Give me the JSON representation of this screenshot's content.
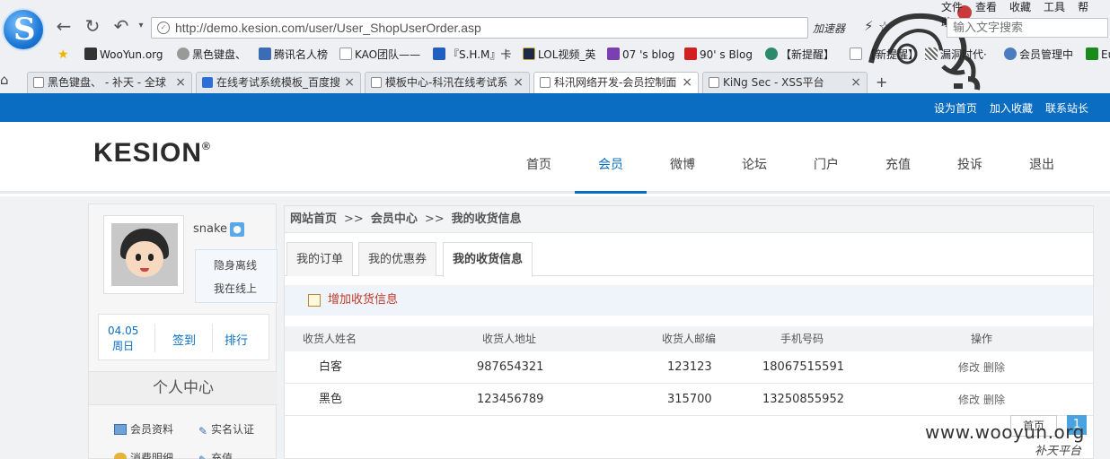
{
  "browser": {
    "url": "http://demo.kesion.com/user/User_ShopUserOrder.asp",
    "accelerator": "加速器",
    "menu": [
      "文件",
      "查看",
      "收藏",
      "工具",
      "帮助"
    ],
    "search_placeholder": "输入文字搜索",
    "bookmarks": [
      {
        "label": "WooYun.org",
        "icon": "wooyun-icon",
        "color": "#333333"
      },
      {
        "label": "黑色键盘、",
        "icon": "star-icon",
        "color": "#888888"
      },
      {
        "label": "腾讯名人榜",
        "icon": "shield-icon",
        "color": "#3b6db5"
      },
      {
        "label": "KAO团队——",
        "icon": "page-icon",
        "color": "#999999"
      },
      {
        "label": "『S.H.M』卡",
        "icon": "blue-square-icon",
        "color": "#1f5fbf"
      },
      {
        "label": "LOL视频_英",
        "icon": "lol-icon",
        "color": "#c9a23a"
      },
      {
        "label": "07 's blog",
        "icon": "purple-icon",
        "color": "#7a3fb0"
      },
      {
        "label": "90' s Blog",
        "icon": "red-90-icon",
        "color": "#d02020"
      },
      {
        "label": "【新提醒】",
        "icon": "circle-icon",
        "color": "#2a8a6a"
      },
      {
        "label": "【新提醒】",
        "icon": "page-icon",
        "color": "#999999"
      },
      {
        "label": "漏洞时代·",
        "icon": "pattern-icon",
        "color": "#666666"
      },
      {
        "label": "会员管理中",
        "icon": "people-icon",
        "color": "#4c7cc0"
      },
      {
        "label": "Eu",
        "icon": "green-icon",
        "color": "#1a8a1a"
      }
    ],
    "tabs": [
      {
        "label": "黑色键盘、 - 补天 - 全球",
        "active": false
      },
      {
        "label": "在线考试系统模板_百度搜",
        "active": false
      },
      {
        "label": "模板中心-科汛在线考试系",
        "active": false
      },
      {
        "label": "科汛网络开发-会员控制面",
        "active": true
      },
      {
        "label": "KiNg Sec - XSS平台",
        "active": false
      }
    ]
  },
  "site": {
    "top_links": [
      "设为首页",
      "加入收藏",
      "联系站长"
    ],
    "logo": "KESION",
    "logo_mark": "®",
    "nav": [
      {
        "label": "首页",
        "active": false
      },
      {
        "label": "会员",
        "active": true
      },
      {
        "label": "微博",
        "active": false
      },
      {
        "label": "论坛",
        "active": false
      },
      {
        "label": "门户",
        "active": false
      },
      {
        "label": "充值",
        "active": false
      },
      {
        "label": "投诉",
        "active": false
      },
      {
        "label": "退出",
        "active": false
      }
    ],
    "accent": "#0a6dc2"
  },
  "sidebar": {
    "username": "snake",
    "status_options": [
      "隐身离线",
      "我在线上"
    ],
    "sign_date": "04.05",
    "sign_weekday": "周日",
    "sign_label": "签到",
    "rank_label": "排行",
    "center_title": "个人中心",
    "links": [
      "会员资料",
      "实名认证",
      "消费明细",
      "充值"
    ]
  },
  "content": {
    "breadcrumb": [
      "网站首页",
      "会员中心",
      "我的收货信息"
    ],
    "breadcrumb_sep": ">>",
    "subtabs": [
      {
        "label": "我的订单",
        "active": false
      },
      {
        "label": "我的优惠券",
        "active": false
      },
      {
        "label": "我的收货信息",
        "active": true
      }
    ],
    "add_label": "增加收货信息",
    "table": {
      "headers": [
        "收货人姓名",
        "收货人地址",
        "收货人邮编",
        "手机号码",
        "操作"
      ],
      "rows": [
        {
          "name": "白客",
          "address": "987654321",
          "zip": "123123",
          "phone": "18067515591",
          "edit": "修改",
          "delete": "删除"
        },
        {
          "name": "黑色",
          "address": "123456789",
          "zip": "315700",
          "phone": "13250855952",
          "edit": "修改",
          "delete": "删除"
        }
      ]
    },
    "pager": {
      "first": "首页",
      "current": "1"
    }
  },
  "watermark": {
    "domain": "www.wooyun.org",
    "sub": "补天平台"
  }
}
